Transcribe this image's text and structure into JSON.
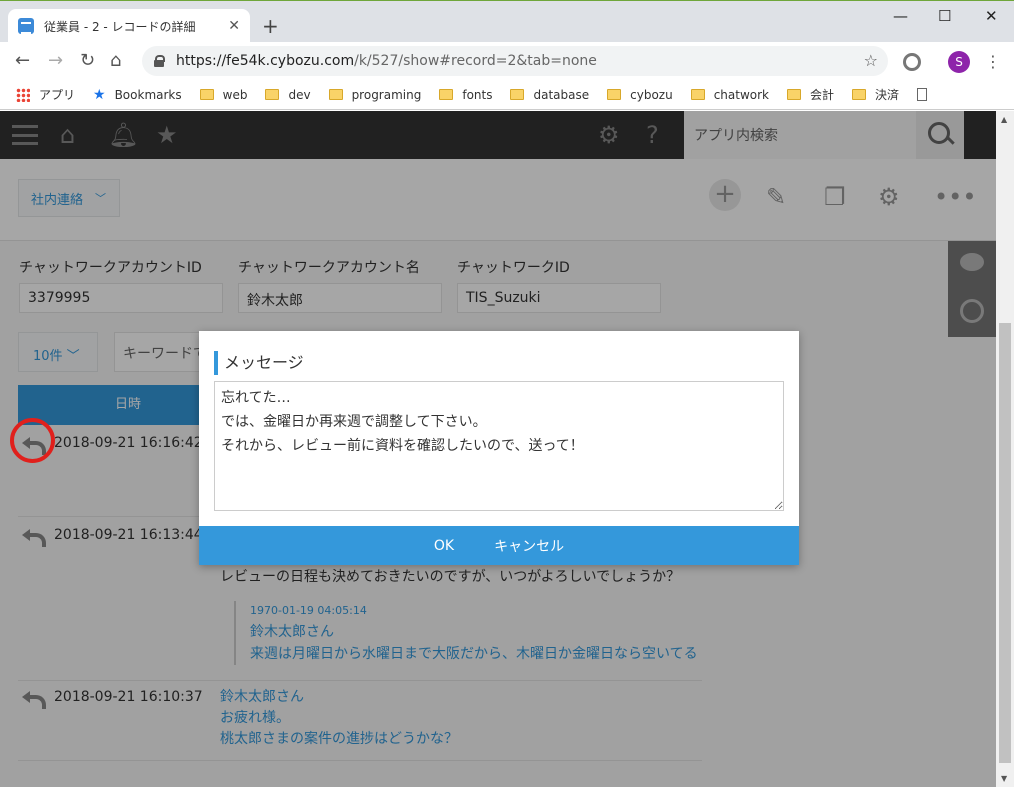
{
  "browser": {
    "tab_title": "従業員 - 2 - レコードの詳細",
    "url_host": "https://fe54k.cybozu.com",
    "url_path": "/k/527/show#record=2&tab=none",
    "profile_initial": "S",
    "bookmarks": [
      "アプリ",
      "Bookmarks",
      "web",
      "dev",
      "programing",
      "fonts",
      "database",
      "cybozu",
      "chatwork",
      "会計",
      "決済"
    ]
  },
  "app": {
    "search_placeholder": "アプリ内検索",
    "view_name": "社内連絡",
    "fields": [
      {
        "label": "チャットワークアカウントID",
        "value": "3379995"
      },
      {
        "label": "チャットワークアカウント名",
        "value": "鈴木太郎"
      },
      {
        "label": "チャットワークID",
        "value": "TIS_Suzuki"
      }
    ],
    "pager": "10件",
    "keyword_placeholder": "キーワードで",
    "column_header": "日時",
    "rows": [
      {
        "date": "2018-09-21 16:16:42"
      },
      {
        "date": "2018-09-21 16:13:44",
        "message": "レビューの日程も決めておきたいのですが、いつがよろしいでしょうか？",
        "quote_date": "1970-01-19 04:05:14",
        "quote_lines": [
          "鈴木太郎さん",
          "来週は月曜日から水曜日まで大阪だから、木曜日か金曜日なら空いてる"
        ]
      },
      {
        "date": "2018-09-21 16:10:37",
        "lines": [
          "鈴木太郎さん",
          "お疲れ様。",
          "桃太郎さまの案件の進捗はどうかな？"
        ]
      }
    ]
  },
  "dialog": {
    "title": "メッセージ",
    "text": "忘れてた…\nでは、金曜日か再来週で調整して下さい。\nそれから、レビュー前に資料を確認したいので、送って！",
    "ok_label": "OK",
    "cancel_label": "キャンセル"
  }
}
